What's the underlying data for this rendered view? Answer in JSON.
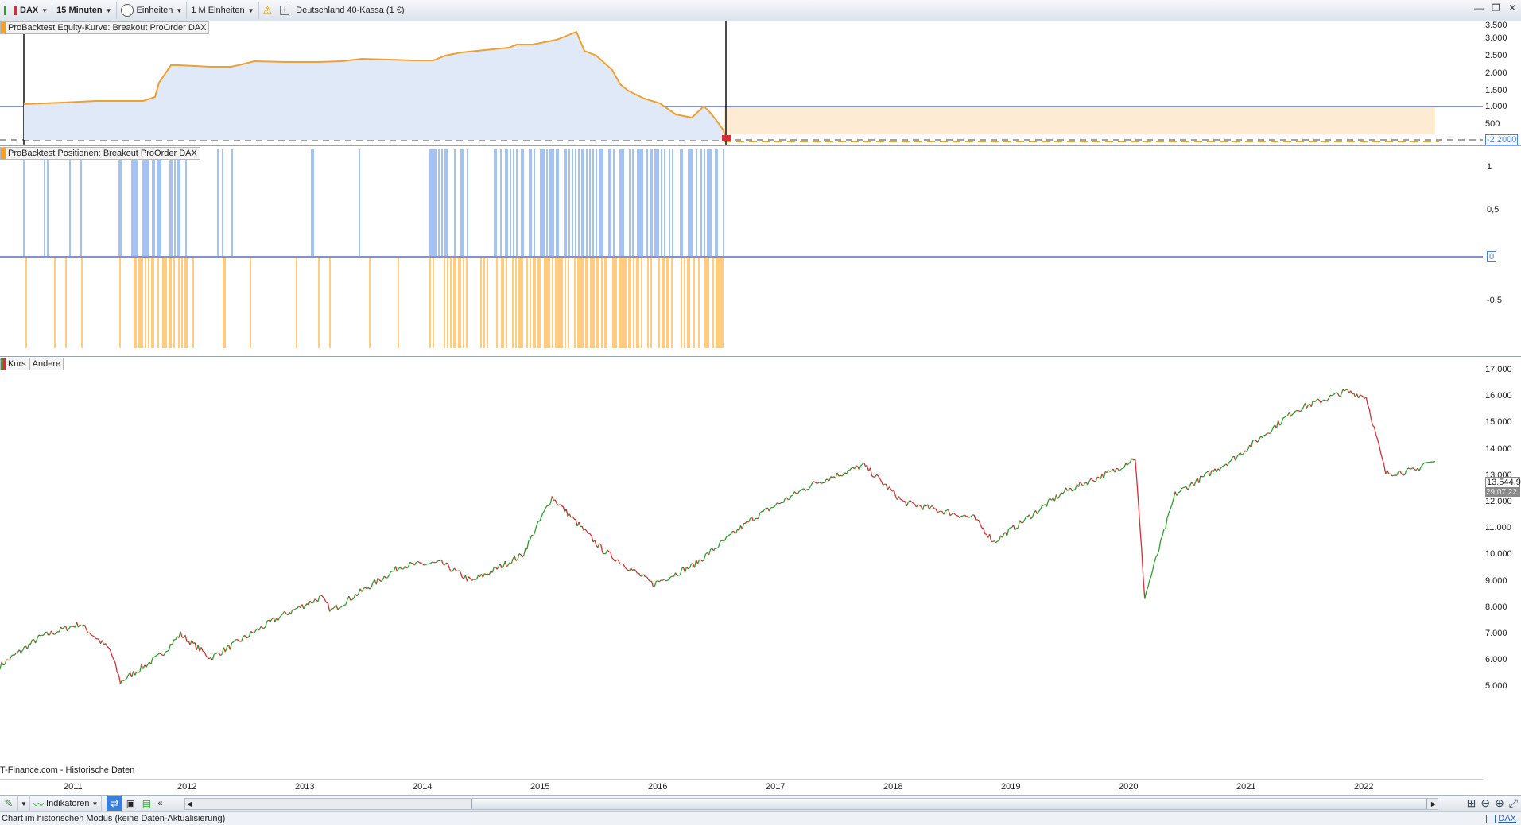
{
  "toolbar": {
    "symbol": "DAX",
    "timeframe": "15 Minuten",
    "units": "Einheiten",
    "units_count": "1 M Einheiten",
    "instrument": "Deutschland 40-Kassa (1 €)"
  },
  "equity_panel": {
    "label": "ProBacktest Equity-Kurve: Breakout ProOrder DAX",
    "axis": [
      "3.500",
      "3.000",
      "2.500",
      "2.000",
      "1.500",
      "1.000",
      "500"
    ],
    "current_value": "-2,2000"
  },
  "positions_panel": {
    "label": "ProBacktest Positionen: Breakout ProOrder DAX",
    "axis": [
      "1",
      "0,5",
      "0",
      "-0,5"
    ]
  },
  "price_panel": {
    "tab_kurs": "Kurs",
    "tab_andere": "Andere",
    "axis": [
      "17.000",
      "16.000",
      "15.000",
      "14.000",
      "13.000",
      "12.000",
      "11.000",
      "10.000",
      "9.000",
      "8.000",
      "7.000",
      "6.000",
      "5.000"
    ],
    "last_price": "13.544,9",
    "last_date": "29.07.22",
    "source": "T-Finance.com - Historische Daten",
    "years": [
      "2011",
      "2012",
      "2013",
      "2014",
      "2015",
      "2016",
      "2017",
      "2018",
      "2019",
      "2020",
      "2021",
      "2022"
    ]
  },
  "bottombar": {
    "indicators": "Indikatoren"
  },
  "status": {
    "text": "Chart im historischen Modus (keine Daten-Aktualisierung)",
    "symbol": "DAX"
  },
  "colors": {
    "up": "#2e9e2e",
    "down": "#d0303a",
    "equity_line": "#f0a030",
    "equity_line_blue": "#4a7fd8",
    "long": "#4a86e8",
    "short": "#ff9900"
  },
  "chart_data": {
    "type": "line",
    "title": "",
    "series": [
      {
        "name": "Kurs",
        "x": [
          "2010-09",
          "2011-01",
          "2011-05",
          "2011-08",
          "2011-09",
          "2012-01",
          "2012-03",
          "2012-06",
          "2013-01",
          "2013-05",
          "2013-06",
          "2014-01",
          "2014-05",
          "2014-08",
          "2015-01",
          "2015-04",
          "2015-09",
          "2016-02",
          "2016-06",
          "2016-12",
          "2017-06",
          "2017-11",
          "2018-03",
          "2018-10",
          "2018-12",
          "2019-07",
          "2019-12",
          "2020-02",
          "2020-03",
          "2020-06",
          "2020-12",
          "2021-06",
          "2021-11",
          "2022-01",
          "2022-03",
          "2022-06",
          "2022-07"
        ],
        "values": [
          5800,
          6900,
          7400,
          6400,
          5200,
          6200,
          7000,
          6100,
          7700,
          8400,
          7900,
          9600,
          9700,
          9000,
          10000,
          12200,
          10200,
          8900,
          9600,
          11400,
          12700,
          13400,
          12000,
          11400,
          10500,
          12400,
          13200,
          13700,
          8400,
          12300,
          13700,
          15500,
          16200,
          16000,
          13100,
          13200,
          13545
        ]
      }
    ],
    "ylim": [
      4700,
      17300
    ]
  }
}
